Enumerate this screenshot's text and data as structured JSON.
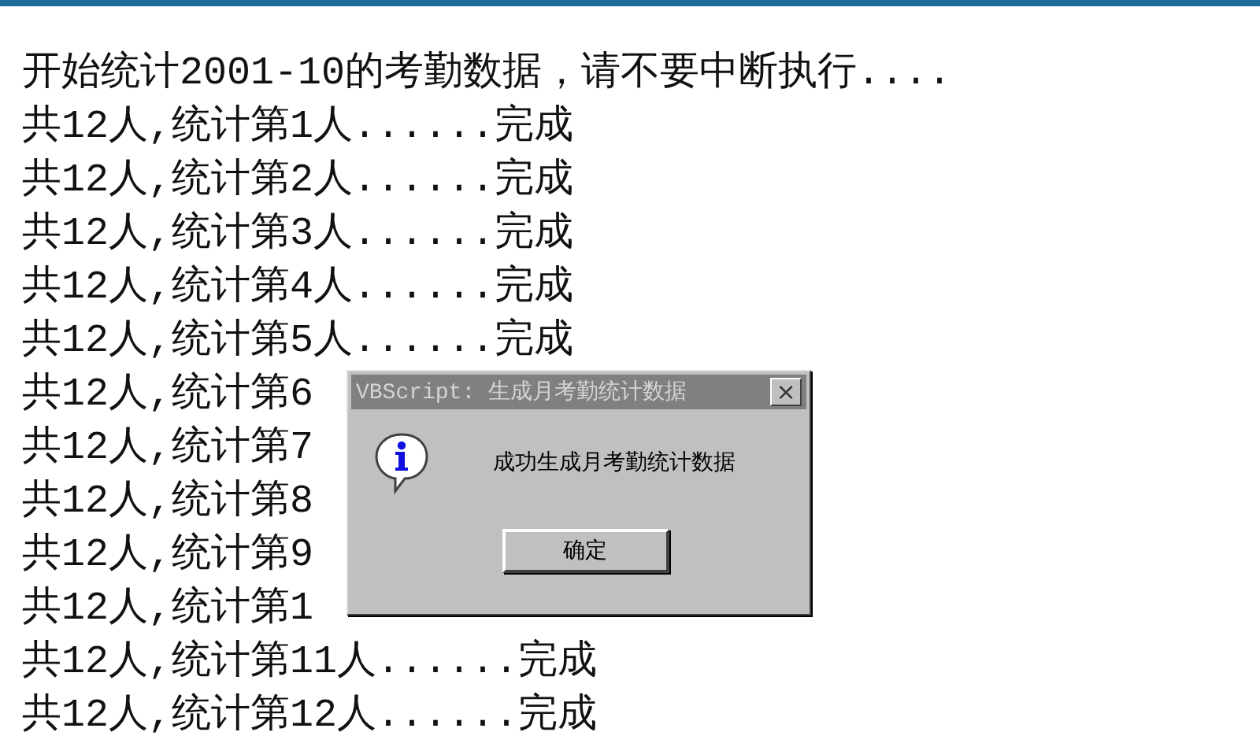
{
  "log_lines": [
    "开始统计2001-10的考勤数据，请不要中断执行....",
    "共12人,统计第1人......完成",
    "共12人,统计第2人......完成",
    "共12人,统计第3人......完成",
    "共12人,统计第4人......完成",
    "共12人,统计第5人......完成",
    "共12人,统计第6",
    "共12人,统计第7",
    "共12人,统计第8",
    "共12人,统计第9",
    "共12人,统计第1",
    "共12人,统计第11人......完成",
    "共12人,统计第12人......完成"
  ],
  "dialog": {
    "title": "VBScript: 生成月考勤统计数据",
    "close": "×",
    "message": "成功生成月考勤统计数据",
    "buttons": [
      "确定"
    ]
  }
}
